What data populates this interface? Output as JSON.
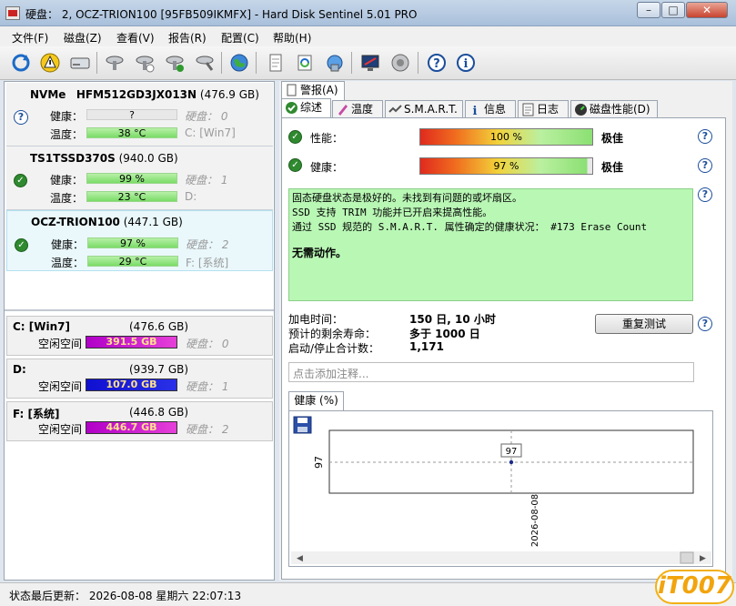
{
  "window": {
    "title": "硬盘： 2, OCZ-TRION100 [95FB509IKMFX]  -  Hard Disk Sentinel 5.01 PRO"
  },
  "menu": [
    "文件(F)",
    "磁盘(Z)",
    "查看(V)",
    "报告(R)",
    "配置(C)",
    "帮助(H)"
  ],
  "left": {
    "labels": {
      "health": "健康：",
      "temp": "温度：",
      "disk_prefix": "硬盘："
    },
    "devices": [
      {
        "name": "NVMe",
        "model": "HFM512GD3JX013N",
        "size": "(476.9 GB)",
        "health": "?",
        "temp": "38 °C",
        "disk": "0",
        "drive": "C: [Win7]",
        "status_icon": "question-icon"
      },
      {
        "name": "TS1TSSD370S",
        "model": "",
        "size": "(940.0 GB)",
        "health": "99 %",
        "temp": "23 °C",
        "disk": "1",
        "drive": "D:",
        "status_icon": "ok-icon"
      },
      {
        "name": "OCZ-TRION100",
        "model": "",
        "size": "(447.1 GB)",
        "health": "97 %",
        "temp": "29 °C",
        "disk": "2",
        "drive": "F: [系统]",
        "status_icon": "ok-icon"
      }
    ],
    "partitions": [
      {
        "name": "C: [Win7]",
        "size": "(476.6 GB)",
        "free_label": "空闲空间",
        "free": "391.5 GB",
        "disk": "0"
      },
      {
        "name": "D:",
        "size": "(939.7 GB)",
        "free_label": "空闲空间",
        "free": "107.0 GB",
        "disk": "1"
      },
      {
        "name": "F: [系统]",
        "size": "(446.8 GB)",
        "free_label": "空闲空间",
        "free": "446.7 GB",
        "disk": "2"
      }
    ]
  },
  "tabs": {
    "alert": "警报(A)",
    "main": [
      "综述",
      "温度",
      "S.M.A.R.T.",
      "信息",
      "日志",
      "磁盘性能(D)"
    ]
  },
  "overview": {
    "performance_label": "性能：",
    "performance_value": "100 %",
    "performance_rating": "极佳",
    "health_label": "健康：",
    "health_value": "97 %",
    "health_rating": "极佳",
    "message_lines": [
      "固态硬盘状态是极好的。未找到有问题的或坏扇区。",
      "SSD 支持 TRIM 功能并已开启来提高性能。",
      "通过 SSD 规范的 S.M.A.R.T. 属性确定的健康状况：  #173 Erase Count"
    ],
    "action": "无需动作。",
    "power_on_label": "加电时间：",
    "power_on_value": "150 日, 10 小时",
    "remaining_label": "预计的剩余寿命：",
    "remaining_value": "多于 1000 日",
    "startstop_label": "启动/停止合计数：",
    "startstop_value": "1,171",
    "retest_button": "重复测试",
    "note_placeholder": "点击添加注释..."
  },
  "chart_tab": "健康 (%)",
  "chart_data": {
    "type": "line",
    "x": [
      "2026-08-08"
    ],
    "y_label_tick": "97",
    "series": [
      {
        "values": [
          97
        ]
      }
    ],
    "data_labels": [
      "97"
    ]
  },
  "status": {
    "text": "状态最后更新：   2026-08-08 星期六 22:07:13"
  },
  "watermark": "iT007"
}
